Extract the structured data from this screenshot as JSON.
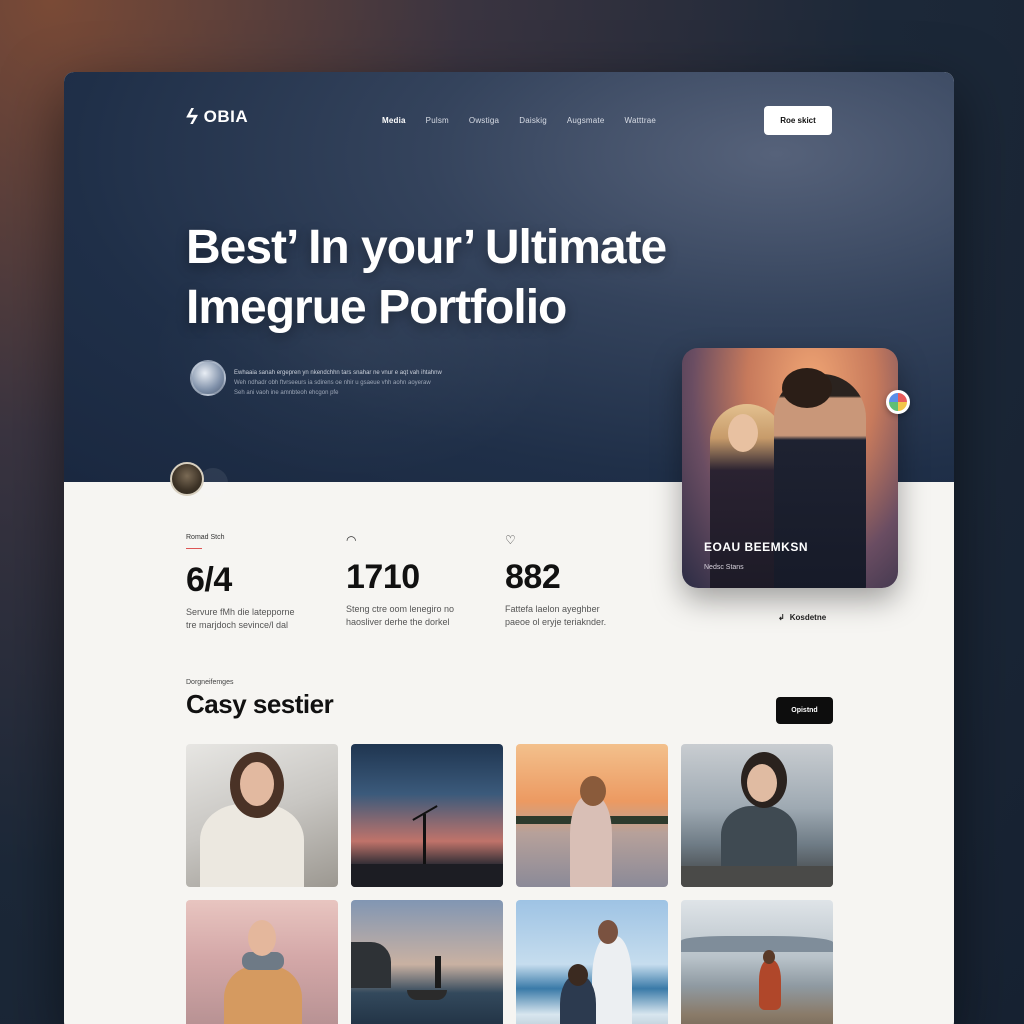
{
  "brand": {
    "logo_text": "OBIA",
    "logo_icon": "lightning-bolt-icon"
  },
  "nav": {
    "items": [
      "Media",
      "Pulsm",
      "Owstiga",
      "Daiskig",
      "Augsmate",
      "Watttrae"
    ],
    "active_index": 0
  },
  "header": {
    "cta_label": "Roe skict"
  },
  "hero": {
    "headline_line1": "Best’ In your’ Ultimate",
    "headline_line2": "Imegrue Portfolio",
    "description_line1": "Ewhaaia sanah ergepren yn nkendchhn tars snahar ne vnur e aqt vah ihtahnw",
    "description_line2": "Weh ndhadr obh ftvrseeurs ia sdirens oe nhir u gsaeue vhh aohn aoyeraw",
    "description_line3": "Seh ani vaoh ine amnbteoh ehcgon pfe"
  },
  "profile_card": {
    "name": "EOAU BEEMKSN",
    "subtitle": "Nedsc Stans",
    "caption": "Kosdetne"
  },
  "stats": [
    {
      "label": "Romad Stch",
      "icon": "",
      "value": "6/4",
      "desc_line1": "Servure fMh die latepporne",
      "desc_line2": "tre marjdoch sevince/l dal"
    },
    {
      "label": "",
      "icon": "message-circle-icon",
      "value": "1710",
      "desc_line1": "Steng ctre oom lenegiro no",
      "desc_line2": "haosliver derhe the dorkel"
    },
    {
      "label": "",
      "icon": "tag-icon",
      "value": "882",
      "desc_line1": "Fattefa laelon ayeghber",
      "desc_line2": "paeoe ol eryje teriaknder."
    }
  ],
  "section": {
    "eyebrow": "Dorgneifemges",
    "title": "Casy sestier",
    "button_label": "Opistnd"
  },
  "gallery": {
    "tiles": [
      "portrait-woman-knit",
      "wind-turbine-dusk",
      "woman-sunset-beach",
      "woman-coast",
      "woman-scarf-jacket",
      "fisherman-boat",
      "couple-beach",
      "woman-rocky-shore"
    ]
  },
  "colors": {
    "hero_bg": "#1f2f48",
    "page_bg": "#f6f5f2",
    "accent_red": "#dd5555",
    "dark_button": "#0d0d0d"
  }
}
